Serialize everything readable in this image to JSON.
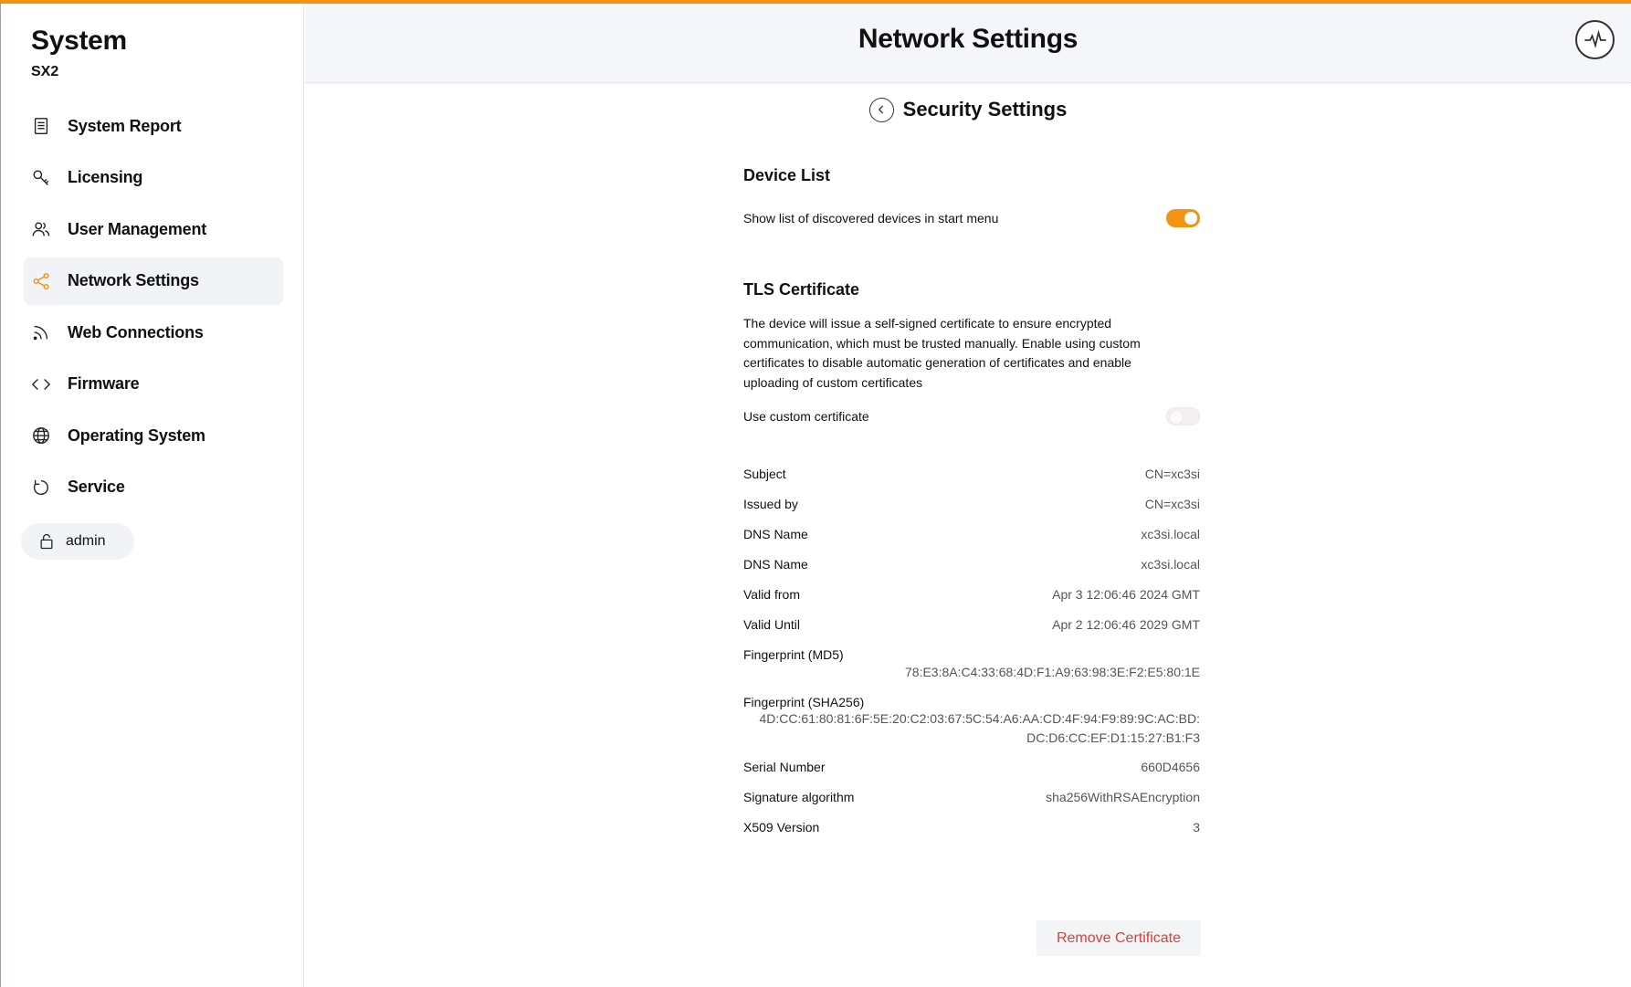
{
  "sidebar": {
    "title": "System",
    "subtitle": "SX2",
    "items": [
      {
        "label": "System Report",
        "icon": "document-icon"
      },
      {
        "label": "Licensing",
        "icon": "key-icon"
      },
      {
        "label": "User Management",
        "icon": "users-icon"
      },
      {
        "label": "Network Settings",
        "icon": "share-icon",
        "active": true
      },
      {
        "label": "Web Connections",
        "icon": "rss-icon"
      },
      {
        "label": "Firmware",
        "icon": "code-icon"
      },
      {
        "label": "Operating System",
        "icon": "globe-icon"
      },
      {
        "label": "Service",
        "icon": "refresh-icon"
      }
    ],
    "user": {
      "name": "admin",
      "icon": "lock-icon"
    }
  },
  "header": {
    "title": "Network Settings",
    "activity_icon": "activity-icon"
  },
  "page": {
    "title": "Security Settings",
    "back_icon": "chevron-left-icon"
  },
  "device_list": {
    "title": "Device List",
    "toggle_label": "Show list of discovered devices in start menu",
    "toggle_on": true
  },
  "tls": {
    "title": "TLS Certificate",
    "description": "The device will issue a self-signed certificate to ensure encrypted communication, which must be trusted manually. Enable using custom certificates to disable automatic generation of certificates and enable uploading of custom certificates",
    "custom_label": "Use custom certificate",
    "custom_on": false
  },
  "certificate": {
    "subject": {
      "label": "Subject",
      "value": "CN=xc3si"
    },
    "issued_by": {
      "label": "Issued by",
      "value": "CN=xc3si"
    },
    "dns1": {
      "label": "DNS Name",
      "value": "xc3si.local"
    },
    "dns2": {
      "label": "DNS Name",
      "value": "xc3si.local"
    },
    "valid_from": {
      "label": "Valid from",
      "value": "Apr 3 12:06:46 2024 GMT"
    },
    "valid_until": {
      "label": "Valid Until",
      "value": "Apr 2 12:06:46 2029 GMT"
    },
    "md5": {
      "label": "Fingerprint (MD5)",
      "value": "78:E3:8A:C4:33:68:4D:F1:A9:63:98:3E:F2:E5:80:1E"
    },
    "sha256": {
      "label": "Fingerprint (SHA256)",
      "value_line1": "4D:CC:61:80:81:6F:5E:20:C2:03:67:5C:54:A6:AA:CD:4F:94:F9:89:9C:AC:BD:",
      "value_line2": "DC:D6:CC:EF:D1:15:27:B1:F3"
    },
    "serial": {
      "label": "Serial Number",
      "value": "660D4656"
    },
    "sig_alg": {
      "label": "Signature algorithm",
      "value": "sha256WithRSAEncryption"
    },
    "x509": {
      "label": "X509 Version",
      "value": "3"
    }
  },
  "actions": {
    "remove_label": "Remove Certificate"
  },
  "colors": {
    "accent": "#f29311",
    "danger": "#d8413a"
  }
}
